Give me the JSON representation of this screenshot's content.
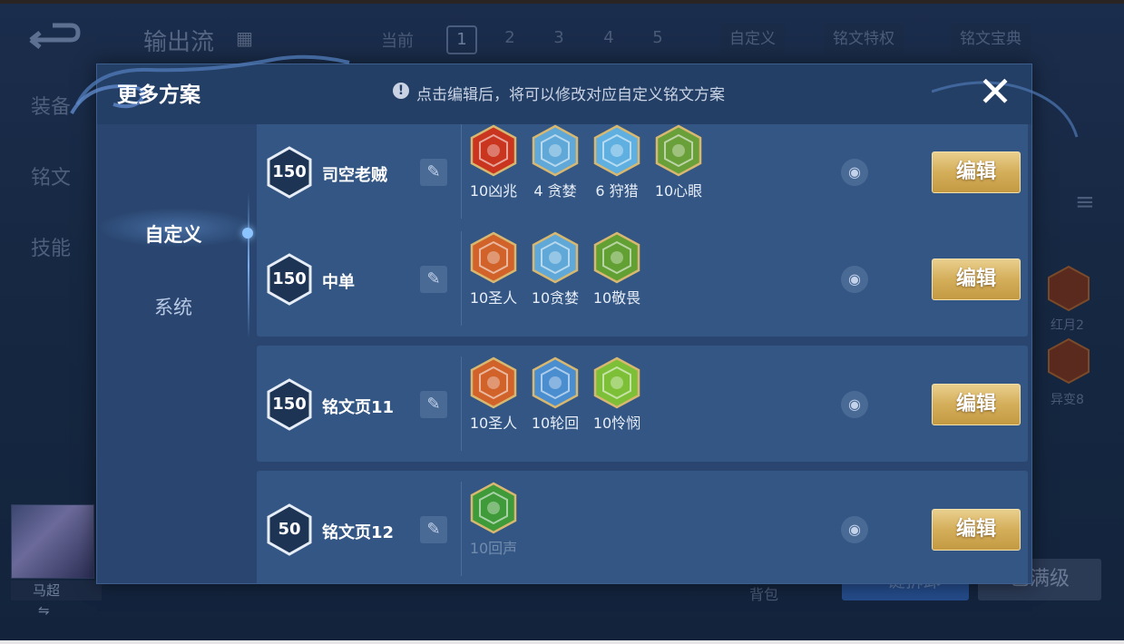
{
  "background": {
    "title": "输出流",
    "current_label": "当前",
    "pages": [
      "1",
      "2",
      "3",
      "4",
      "5"
    ],
    "custom_btn": "自定义",
    "rune_privilege_btn": "铭文特权",
    "rune_codex_btn": "铭文宝典",
    "side_items": [
      "装备",
      "铭文",
      "技能"
    ],
    "hero_name": "马超",
    "rune_labels": [
      "红月2",
      "异变8"
    ],
    "bag_label": "背包",
    "one_click_btn": "一键拆卸",
    "full_level_btn": "已满级"
  },
  "modal": {
    "title": "更多方案",
    "info_text": "点击编辑后，将可以修改对应自定义铭文方案",
    "close_glyph": "✕",
    "tabs": {
      "custom": "自定义",
      "system": "系统"
    },
    "edit_label": "编辑",
    "rows": [
      {
        "level": "150",
        "name": "司空老贼",
        "runes": [
          {
            "label": "10凶兆",
            "color": "#c9351f"
          },
          {
            "label": "4 贪婪",
            "color": "#5fa8d8"
          },
          {
            "label": "6 狩猎",
            "color": "#5fb0e0"
          },
          {
            "label": "10心眼",
            "color": "#6aa03a"
          }
        ]
      },
      {
        "level": "150",
        "name": "中单",
        "runes": [
          {
            "label": "10圣人",
            "color": "#d0622a"
          },
          {
            "label": "10贪婪",
            "color": "#5fa8d8"
          },
          {
            "label": "10敬畏",
            "color": "#62a033"
          }
        ]
      },
      {
        "level": "150",
        "name": "铭文页11",
        "runes": [
          {
            "label": "10圣人",
            "color": "#d0622a"
          },
          {
            "label": "10轮回",
            "color": "#4a8ed0"
          },
          {
            "label": "10怜悯",
            "color": "#7dc038"
          }
        ]
      },
      {
        "level": "50",
        "name": "铭文页12",
        "runes": [
          {
            "label": "10回声",
            "color": "#3f9a3a"
          }
        ]
      }
    ]
  }
}
